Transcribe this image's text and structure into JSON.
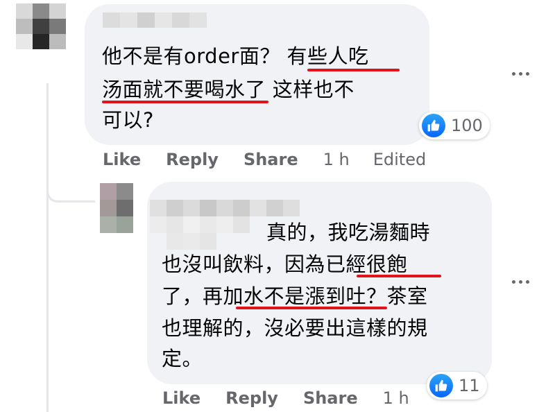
{
  "comment1": {
    "text_lines": [
      "他不是有order面？ 有些人吃",
      "汤面就不要喝水了 这样也不",
      "可以?"
    ],
    "reaction_icon": "like-icon",
    "reaction_count": "100",
    "actions": {
      "like": "Like",
      "reply": "Reply",
      "share": "Share",
      "time": "1 h",
      "edited": "Edited"
    }
  },
  "reply1": {
    "text_lines": [
      "真的，我吃湯麵時",
      "也沒叫飲料，因為已經很飽",
      "了，再加水不是漲到吐？茶室",
      "也理解的，沒必要出這樣的規",
      "定。"
    ],
    "reaction_icon": "like-icon",
    "reaction_count": "11",
    "actions": {
      "like": "Like",
      "reply": "Reply",
      "share": "Share",
      "time": "1 h"
    }
  },
  "colors": {
    "bubble": "#f0f2f5",
    "underline": "#e1141c",
    "like_blue": "#0866ff",
    "muted": "#65676b"
  }
}
